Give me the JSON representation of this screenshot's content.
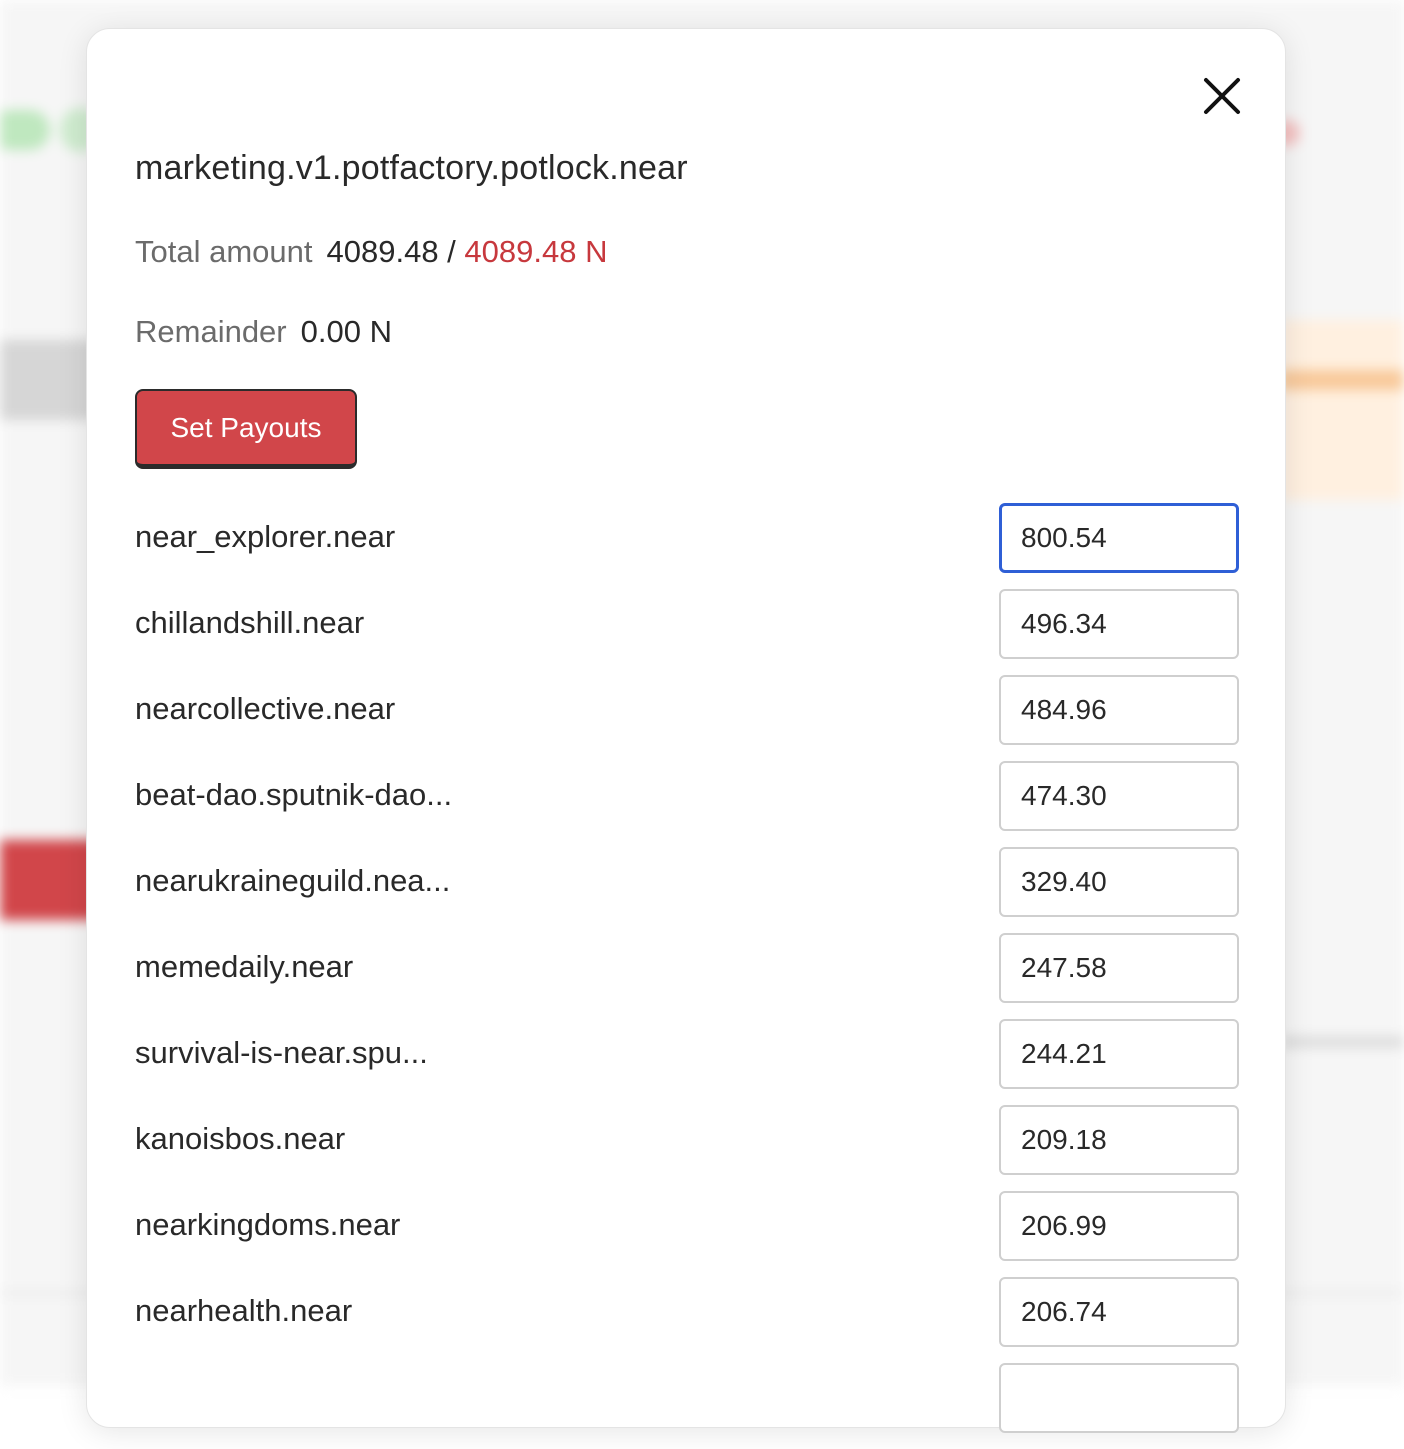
{
  "modal": {
    "title": "marketing.v1.potfactory.potlock.near",
    "total": {
      "label": "Total amount",
      "current": "4089.48 /",
      "target": "4089.48 N"
    },
    "remainder": {
      "label": "Remainder",
      "value": "0.00 N"
    },
    "set_payouts_label": "Set Payouts",
    "close_icon": "close-icon",
    "accent_color": "#d1464a",
    "focus_color": "#2f5fd6"
  },
  "payouts": [
    {
      "name": "near_explorer.near",
      "amount": "800.54",
      "focused": true
    },
    {
      "name": "chillandshill.near",
      "amount": "496.34"
    },
    {
      "name": "nearcollective.near",
      "amount": "484.96"
    },
    {
      "name": "beat-dao.sputnik-dao...",
      "amount": "474.30"
    },
    {
      "name": "nearukraineguild.nea...",
      "amount": "329.40"
    },
    {
      "name": "memedaily.near",
      "amount": "247.58"
    },
    {
      "name": "survival-is-near.spu...",
      "amount": "244.21"
    },
    {
      "name": "kanoisbos.near",
      "amount": "209.18"
    },
    {
      "name": "nearkingdoms.near",
      "amount": "206.99"
    },
    {
      "name": "nearhealth.near",
      "amount": "206.74"
    },
    {
      "name": "",
      "amount": ""
    }
  ]
}
